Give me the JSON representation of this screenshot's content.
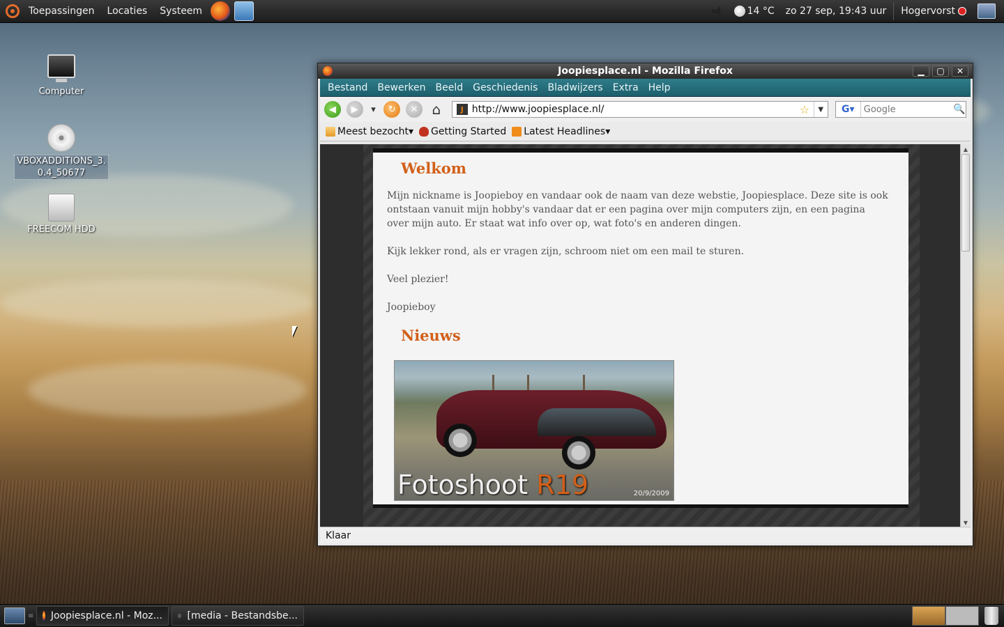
{
  "top_panel": {
    "menus": [
      "Toepassingen",
      "Locaties",
      "Systeem"
    ],
    "weather": "14 °C",
    "clock": "zo 27 sep, 19:43 uur",
    "user": "Hogervorst"
  },
  "desktop_icons": [
    {
      "label": "Computer",
      "icon": "computer-icon"
    },
    {
      "label": "VBOXADDITIONS_3.0.4_50677",
      "icon": "cd-icon"
    },
    {
      "label": "FREECOM HDD",
      "icon": "hdd-icon"
    }
  ],
  "firefox": {
    "title": "Joopiesplace.nl - Mozilla Firefox",
    "menu": [
      "Bestand",
      "Bewerken",
      "Beeld",
      "Geschiedenis",
      "Bladwijzers",
      "Extra",
      "Help"
    ],
    "url": "http://www.joopiesplace.nl/",
    "search_placeholder": "Google",
    "bookmarks": [
      "Meest bezocht",
      "Getting Started",
      "Latest Headlines"
    ],
    "status": "Klaar",
    "page": {
      "welcome_title": "Welkom",
      "paragraphs": [
        "Mijn nickname is Joopieboy en vandaar ook de naam van deze webstie, Joopiesplace. Deze site is ook ontstaan vanuit mijn hobby's vandaar dat er een pagina over mijn computers zijn, en een pagina over mijn auto. Er staat wat info over op, wat foto's en anderen dingen.",
        "Kijk lekker rond, als er vragen zijn, schroom niet om een mail te sturen.",
        "Veel plezier!",
        "Joopieboy"
      ],
      "news_title": "Nieuws",
      "news_caption_prefix": "Fotoshoot",
      "news_caption_highlight": "R19",
      "news_date": "20/9/2009"
    }
  },
  "taskbar": {
    "tasks": [
      "Joopiesplace.nl - Moz...",
      "[media - Bestandsbe..."
    ]
  },
  "colors": {
    "accent_orange": "#d2601a",
    "menubar_teal": "#1d5f6c"
  }
}
